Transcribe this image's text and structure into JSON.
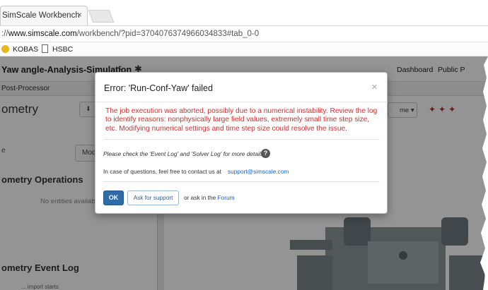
{
  "browser": {
    "tab_title": "SimScale Workbench",
    "tab_close": "×",
    "url_prefix": "://",
    "url_host": "www.simscale.com",
    "url_path": "/workbench/?pid=3704076374966034833#tab_0-0",
    "bookmarks": [
      {
        "label": "KOBAS",
        "icon": "kobas-icon"
      },
      {
        "label": "HSBC",
        "icon": "page-icon"
      }
    ]
  },
  "app": {
    "title": "Yaw angle-Analysis-Simulation",
    "share_icon": "share-icon",
    "settings_icon": "gear-icon",
    "nav": {
      "dashboard": "Dashboard",
      "public": "Public P"
    },
    "subtab": "Post-Processor",
    "panel_title": "ometry",
    "download_glyph": "⬇",
    "mod_button": "Mod",
    "e_label": "e",
    "geometry_operations": "ometry Operations",
    "no_entities": "No entities available",
    "event_log": "ometry Event Log",
    "log_line": "... import starts",
    "select_label": "me ▾"
  },
  "modal": {
    "title": "Error: 'Run-Conf-Yaw' failed",
    "close": "×",
    "error_line1": "The job execution was aborted, possibly due to a numerical instability. Review the log",
    "error_line2": "to identify reasons: nonphysically large field values, extremely small time step size,",
    "error_line3": "etc. Modifying numerical settings and time step size could resolve the issue.",
    "check_logs": "Please check the 'Event Log' and 'Solver Log' for more details.",
    "help_glyph": "?",
    "contact_prefix": "In case of questions, feel free to contact us at",
    "contact_email": "support@simscale.com",
    "ok_label": "OK",
    "support_label": "Ask for support",
    "forum_prefix": "or ask in the",
    "forum_label": "Forum"
  },
  "colors": {
    "error_red": "#d32f2f",
    "link_blue": "#1565c0",
    "primary_button": "#2f6ba8"
  }
}
